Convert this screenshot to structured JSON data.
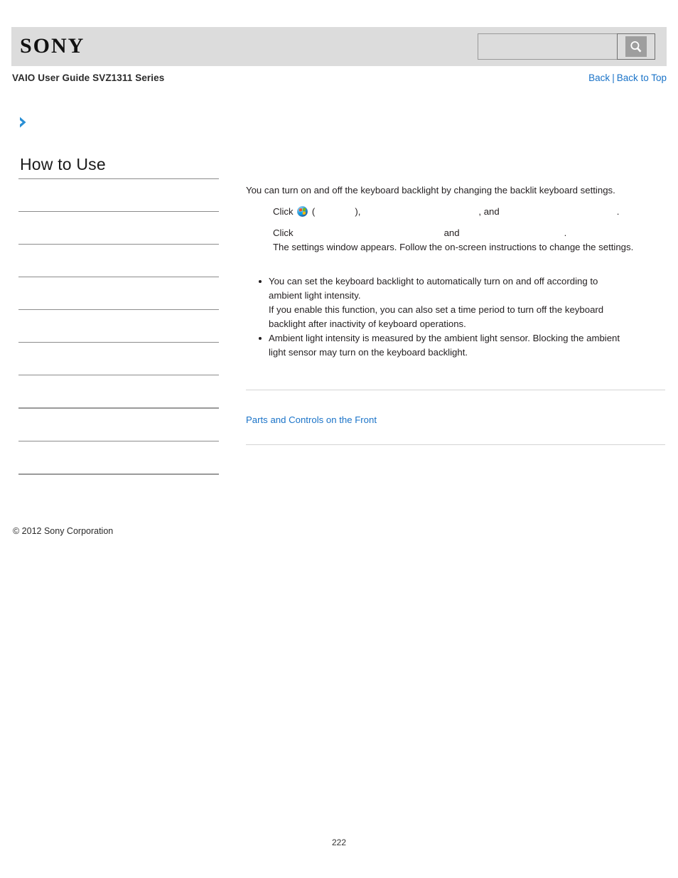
{
  "header": {
    "logo_text": "SONY",
    "search": {
      "value": "",
      "placeholder": "",
      "icon": "search-icon",
      "button_title": "Search"
    }
  },
  "subheader": {
    "guide_title": "VAIO User Guide SVZ1311 Series",
    "nav": {
      "back_label": "Back",
      "separator": "|",
      "back_to_top_label": "Back to Top"
    }
  },
  "breadcrumb_icon": "chevron-right-icon",
  "sidebar": {
    "title": "How to Use",
    "items": [
      {
        "label": ""
      },
      {
        "label": ""
      },
      {
        "label": ""
      },
      {
        "label": ""
      },
      {
        "label": ""
      },
      {
        "label": ""
      },
      {
        "label": ""
      },
      {
        "label": ""
      },
      {
        "label": ""
      },
      {
        "label": ""
      }
    ]
  },
  "content": {
    "lead": "You can turn on and off the keyboard backlight by changing the backlit keyboard settings.",
    "steps": [
      {
        "prefix": "Click",
        "icon": "windows-start-orb-icon",
        "open_paren": "(",
        "term1": "",
        "close_paren": "),",
        "term2": "",
        "conjunction": ", and",
        "term3": "",
        "period": "."
      },
      {
        "prefix": "Click",
        "term1": "",
        "conjunction": "and",
        "term2": "",
        "period": ".",
        "result": "The settings window appears. Follow the on-screen instructions to change the settings."
      }
    ],
    "notes": [
      [
        "You can set the keyboard backlight to automatically turn on and off according to",
        "ambient light intensity.",
        "If you enable this function, you can also set a time period to turn off the keyboard",
        "backlight after inactivity of keyboard operations."
      ],
      [
        "Ambient light intensity is measured by the ambient light sensor. Blocking the ambient",
        "light sensor may turn on the keyboard backlight."
      ]
    ],
    "related_link": "Parts and Controls on the Front"
  },
  "footer": {
    "copyright": "© 2012 Sony Corporation",
    "page_number": "222"
  },
  "colors": {
    "link": "#1a73c8",
    "header_band": "#dcdcdc",
    "rule": "#8c8c8c",
    "chevron": "#2a8fd4"
  }
}
